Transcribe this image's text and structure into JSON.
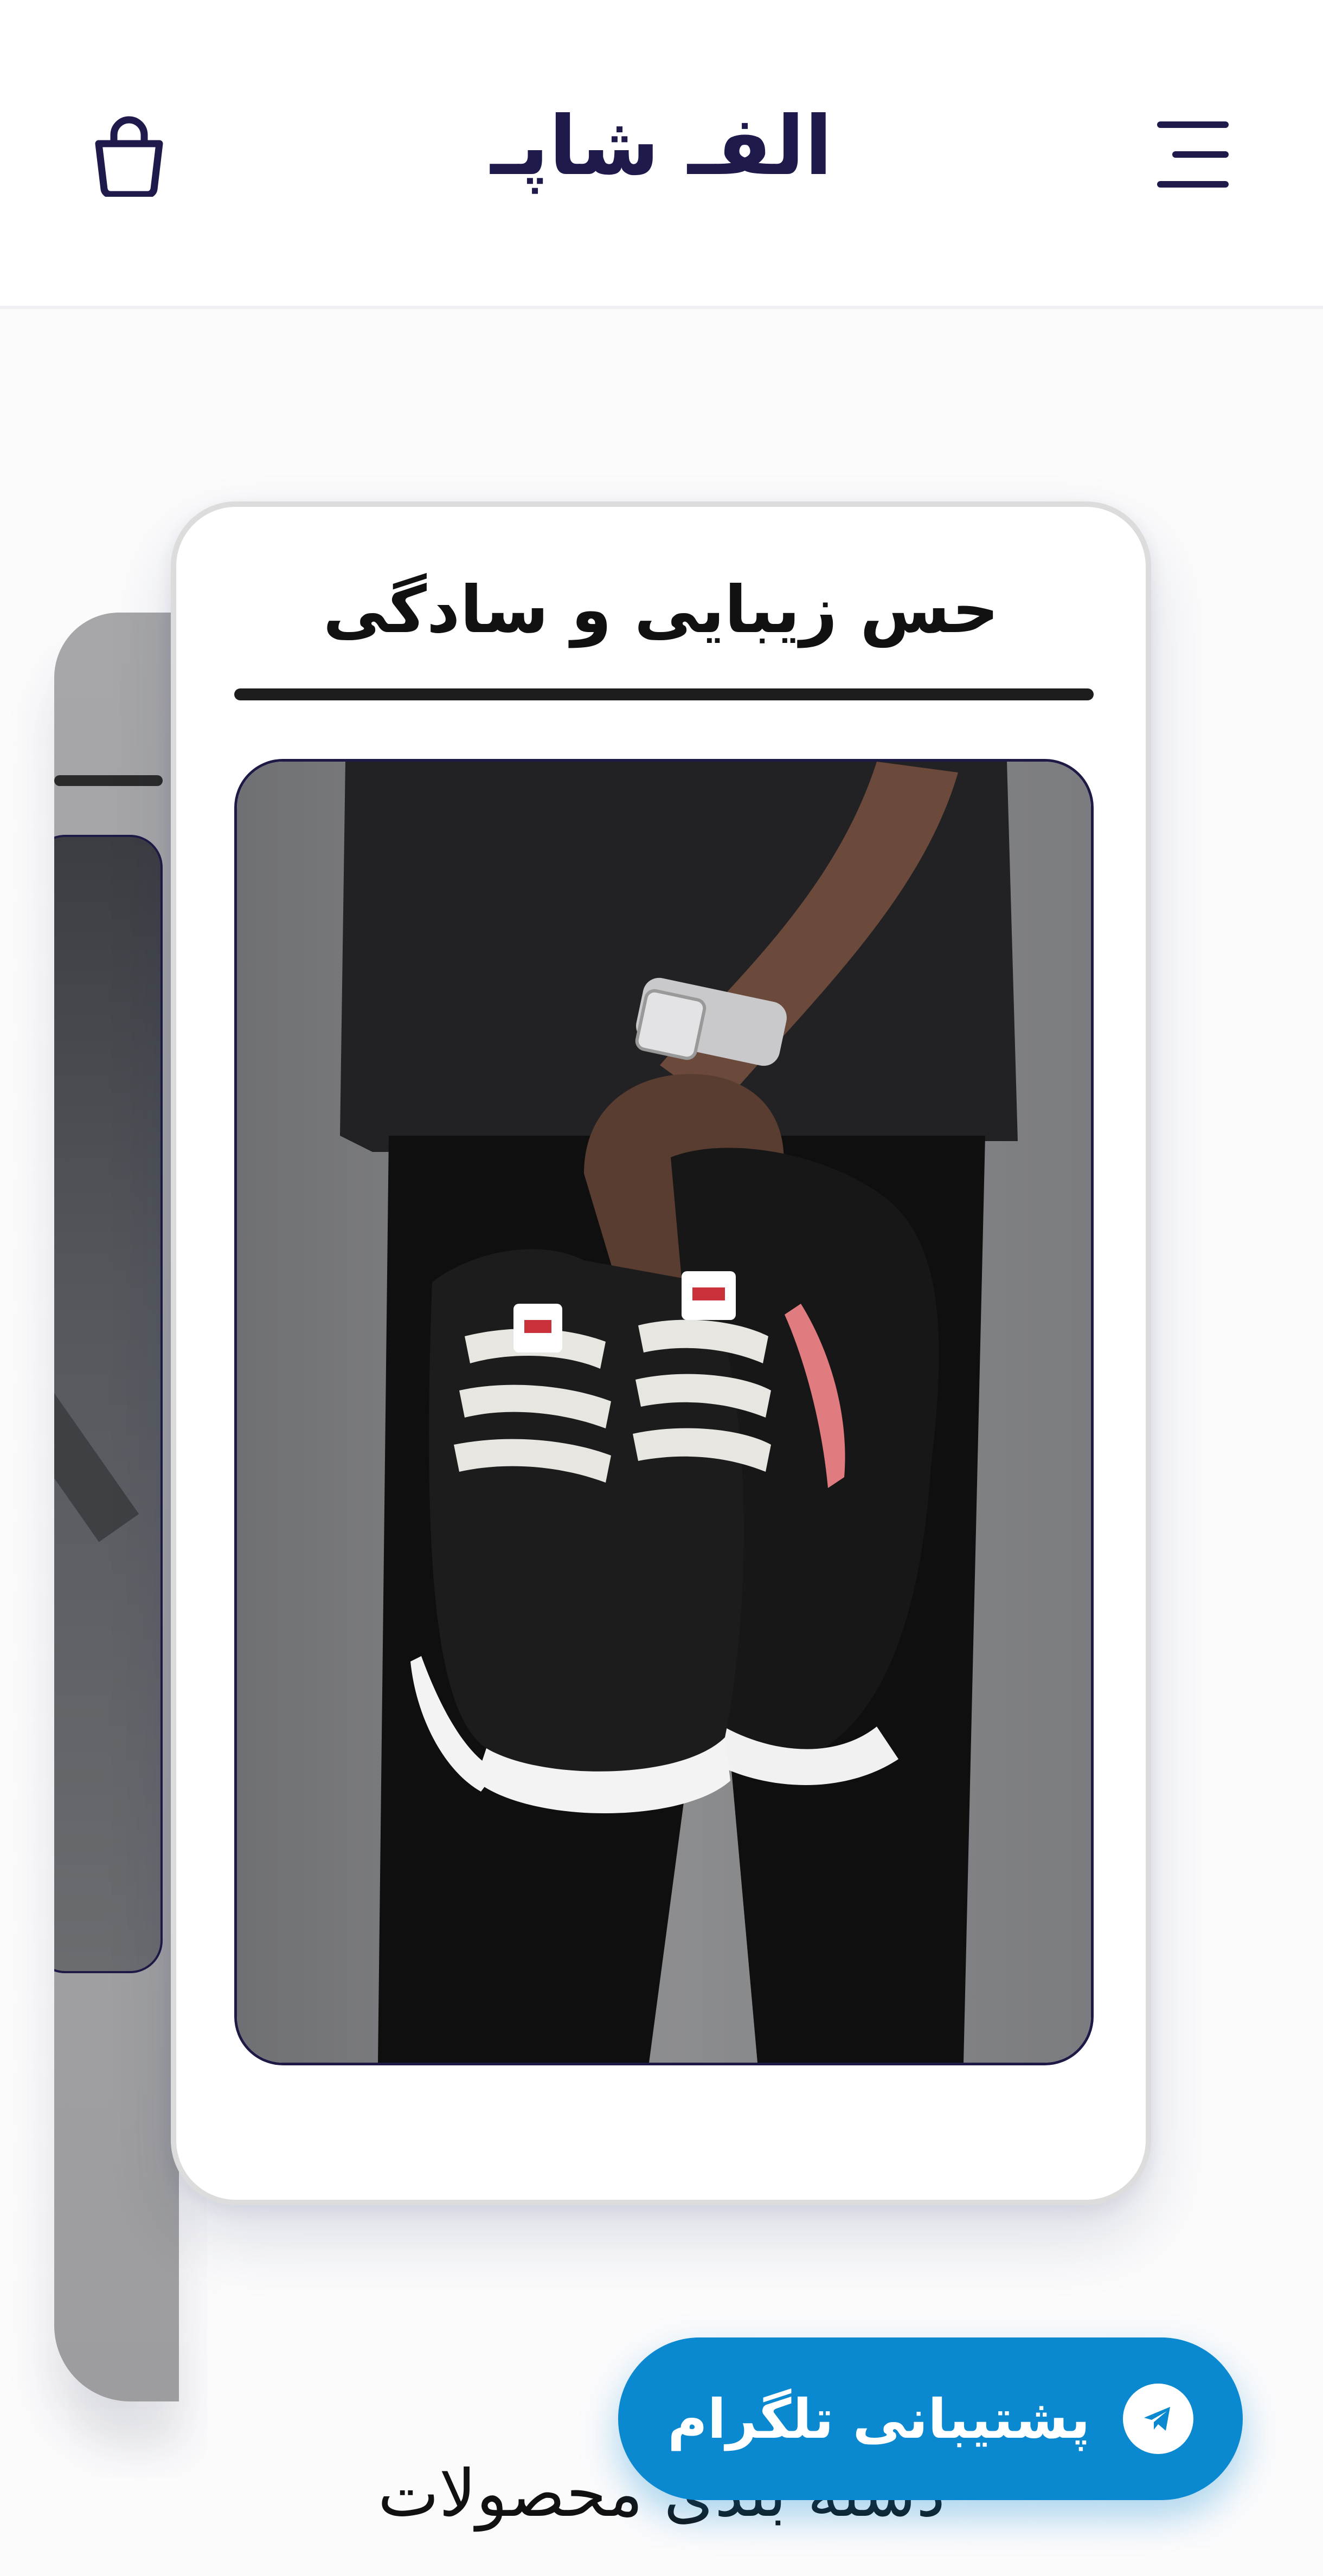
{
  "header": {
    "logo": "الفـ شاپـ",
    "cart_icon": "shopping-bag-icon",
    "menu_icon": "hamburger-menu-icon"
  },
  "slider": {
    "active_slide": {
      "title": "حس زیبایی و سادگی",
      "image": "person holding black-and-white sneakers"
    }
  },
  "section": {
    "title": "دسته بندی محصولات"
  },
  "telegram": {
    "label": "پشتیبانی تلگرام",
    "icon": "telegram-icon"
  },
  "colors": {
    "brand": "#1e1a4c",
    "telegram": "#0a88d0"
  }
}
